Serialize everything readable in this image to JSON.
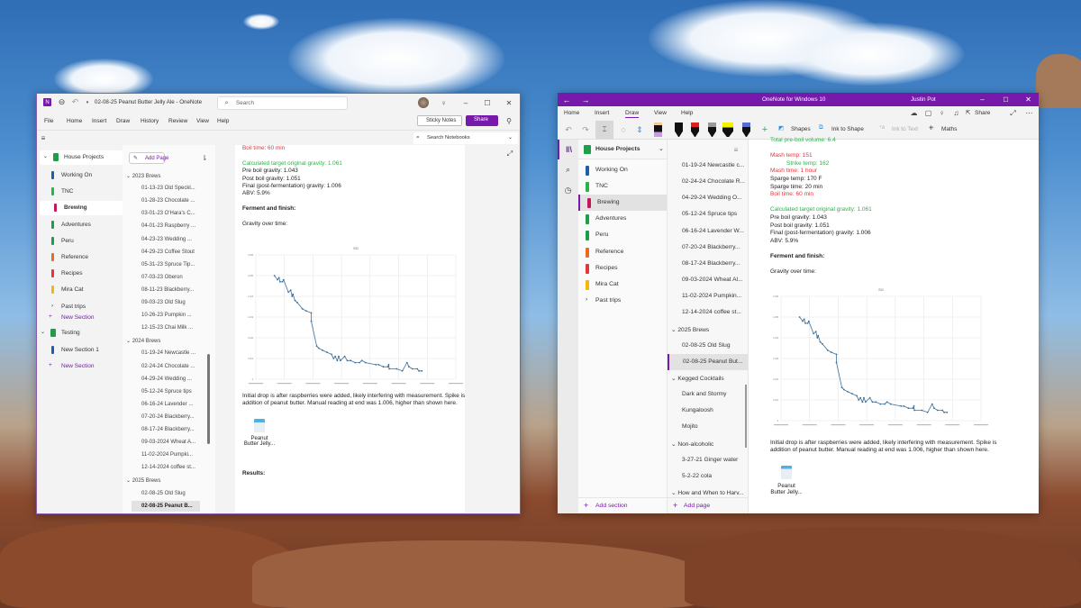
{
  "colors": {
    "onenote_purple": "#7719aa",
    "green_text": "#2bb34a",
    "red_text": "#e8343a",
    "series_line": "#3d6f9a"
  },
  "left_window": {
    "title": "02-08-25 Peanut Butter Jelly Ale  -  OneNote",
    "search_placeholder": "Search",
    "menu": [
      "File",
      "Home",
      "Insert",
      "Draw",
      "History",
      "Review",
      "View",
      "Help"
    ],
    "sticky_notes": "Sticky Notes",
    "share": "Share",
    "search_notebooks": "Search Notebooks",
    "add_page": "Add Page",
    "notebooks": [
      {
        "name": "House Projects",
        "sections": [
          {
            "label": "Working On",
            "color": "#1f5fa8"
          },
          {
            "label": "TNC",
            "color": "#2bb34a"
          },
          {
            "label": "Brewing",
            "color": "#c2185b",
            "selected": true
          },
          {
            "label": "Adventures",
            "color": "#1e9e48"
          },
          {
            "label": "Peru",
            "color": "#1e9e48"
          },
          {
            "label": "Reference",
            "color": "#f06a1c"
          },
          {
            "label": "Recipes",
            "color": "#e8343a"
          },
          {
            "label": "Mira Cat",
            "color": "#f5b800"
          }
        ],
        "group": "Past trips",
        "new_section": "New Section"
      },
      {
        "name": "Testing",
        "sections": [
          {
            "label": "New Section 1",
            "color": "#1f5fa8"
          }
        ],
        "new_section": "New Section"
      }
    ],
    "pages": [
      {
        "group": "2023 Brews"
      },
      "01-13-23 Old Speckl...",
      "01-28-23 Chocolate ...",
      "03-01-23 O'Hara's C...",
      "04-01-23 Raspberry ...",
      "04-23-23 Wedding ...",
      "04-29-23 Coffee Stout",
      "05-31-23 Spruce Tip...",
      "07-03-23 Oberon",
      "08-11-23 Blackberry...",
      "09-03-23 Old Slug",
      "10-26-23 Pumpkin ...",
      "12-15-23 Chai Milk ...",
      {
        "group": "2024 Brews"
      },
      "01-19-24 Newcastle ...",
      "02-24-24 Chocolate ...",
      "04-29-24 Wedding ...",
      "05-12-24 Spruce tips",
      "06-16-24 Lavender ...",
      "07-20-24 Blackberry...",
      "08-17-24 Blackberry...",
      "09-03-2024 Wheat A...",
      "11-02-2024 Pumpki...",
      "12-14-2024 coffee st...",
      {
        "group": "2025 Brews"
      },
      "02-08-25 Old Slug",
      {
        "label": "02-08-25 Peanut B...",
        "selected": true
      }
    ],
    "note": {
      "boil_time": "Boil time: 60 min",
      "target_og": "Calculated target original gravity: 1.061",
      "pre_boil": "Pre boil gravity: 1.043",
      "post_boil": "Post boil gravity: 1.051",
      "final": "Final (post-fermentation) gravity: 1.006",
      "abv": "ABV: 5.9%",
      "ferment": "Ferment and finish:",
      "gravity_over_time": "Gravity over time:",
      "caption": "Initial drop is after raspberries were added, likely interfering with measurement. Spike is addition of peanut butter. Manual reading at end was 1.006, higher than shown here.",
      "attachment_line1": "Peanut",
      "attachment_line2": "Butter Jelly...",
      "results": "Results:"
    }
  },
  "right_window": {
    "title": "OneNote for Windows 10",
    "user": "Justin Pot",
    "tabs": [
      "Home",
      "Insert",
      "Draw",
      "View",
      "Help"
    ],
    "active_tab": "Draw",
    "share": "Share",
    "tools": {
      "shapes": "Shapes",
      "ink_to_shape": "Ink to Shape",
      "ink_to_text": "Ink to Text",
      "maths": "Maths"
    },
    "notebook": "House Projects",
    "sections": [
      {
        "label": "Working On",
        "color": "#1f5fa8"
      },
      {
        "label": "TNC",
        "color": "#2bb34a"
      },
      {
        "label": "Brewing",
        "color": "#c2185b",
        "selected": true
      },
      {
        "label": "Adventures",
        "color": "#1e9e48"
      },
      {
        "label": "Peru",
        "color": "#1e9e48"
      },
      {
        "label": "Reference",
        "color": "#f06a1c"
      },
      {
        "label": "Recipes",
        "color": "#e8343a"
      },
      {
        "label": "Mira Cat",
        "color": "#f5b800"
      }
    ],
    "group": "Past trips",
    "add_section": "Add section",
    "add_page": "Add page",
    "pages": [
      "01-19-24 Newcastle c...",
      "02-24-24 Chocolate R...",
      "04-29-24 Wedding O...",
      "05-12-24 Spruce tips",
      "06-16-24 Lavender W...",
      "07-20-24 Blackberry...",
      "08-17-24 Blackberry...",
      "09-03-2024 Wheat Al...",
      "11-02-2024 Pumpkin...",
      "12-14-2024 coffee st...",
      {
        "group": "2025 Brews"
      },
      "02-08-25 Old Slug",
      {
        "label": "02-08-25 Peanut But...",
        "selected": true
      },
      {
        "group": "Kegged Cocktails"
      },
      "Dark and Stormy",
      "Kungaloosh",
      "Mojito",
      {
        "group": "Non-alcoholic"
      },
      "3-27-21 Ginger water",
      "5-2-22 cola",
      {
        "group": "How and When to Harv..."
      }
    ],
    "note": {
      "preboil_volume": "Total pre-boil volume: 6.4",
      "mash_temp": "Mash temp: 151",
      "strike_temp": "Strike temp:  162",
      "mash_time": "Mash time: 1 hour",
      "sparge_temp": "Sparge temp: 170 F",
      "sparge_time": "Sparge time: 20 min",
      "boil_time": "Boil time: 60 min",
      "target_og": "Calculated target original gravity: 1.061",
      "pre_boil": "Pre boil gravity: 1.043",
      "post_boil": "Post boil gravity: 1.051",
      "final": "Final (post-fermentation) gravity: 1.006",
      "abv": "ABV: 5.9%",
      "ferment": "Ferment and finish:",
      "gravity_over_time": "Gravity over time:",
      "caption": "Initial drop is after raspberries were added, likely interfering with measurement. Spike is addition of peanut butter. Manual reading at end was 1.006, higher than shown here.",
      "attachment_line1": "Peanut",
      "attachment_line2": "Butter Jelly..."
    }
  },
  "chart_data": {
    "type": "line",
    "title": "SG",
    "xlabel": "",
    "ylabel": "",
    "grid": true,
    "xlim": [
      0,
      7
    ],
    "ylim": [
      1.0,
      1.06
    ],
    "yticks": [
      1,
      1.01,
      1.02,
      1.03,
      1.04,
      1.05,
      1.06
    ],
    "ytick_labels": [
      "1",
      "1.01",
      "1.02",
      "1.03",
      "1.04",
      "1.05",
      "1.06"
    ],
    "series": [
      {
        "name": "SG",
        "x": [
          0.65,
          0.76,
          0.81,
          0.85,
          0.93,
          0.97,
          1.14,
          1.22,
          1.27,
          1.3,
          1.37,
          1.45,
          1.63,
          1.76,
          1.94,
          1.94,
          2.13,
          2.2,
          2.33,
          2.49,
          2.65,
          2.72,
          2.78,
          2.85,
          2.9,
          2.96,
          3.11,
          3.2,
          3.32,
          3.48,
          3.63,
          3.71,
          3.84,
          4.2,
          4.3,
          4.46,
          4.62,
          4.65,
          4.67,
          4.93,
          5.13,
          5.29,
          5.36,
          5.48,
          5.65,
          5.71,
          5.81
        ],
        "y": [
          1.05,
          1.048,
          1.049,
          1.047,
          1.047,
          1.048,
          1.042,
          1.043,
          1.04,
          1.041,
          1.038,
          1.037,
          1.034,
          1.033,
          1.032,
          1.028,
          1.016,
          1.015,
          1.014,
          1.013,
          1.012,
          1.01,
          1.011,
          1.009,
          1.011,
          1.009,
          1.011,
          1.009,
          1.009,
          1.008,
          1.008,
          1.009,
          1.008,
          1.007,
          1.007,
          1.006,
          1.006,
          1.007,
          1.005,
          1.005,
          1.004,
          1.008,
          1.006,
          1.005,
          1.005,
          1.004,
          1.004
        ]
      }
    ]
  }
}
